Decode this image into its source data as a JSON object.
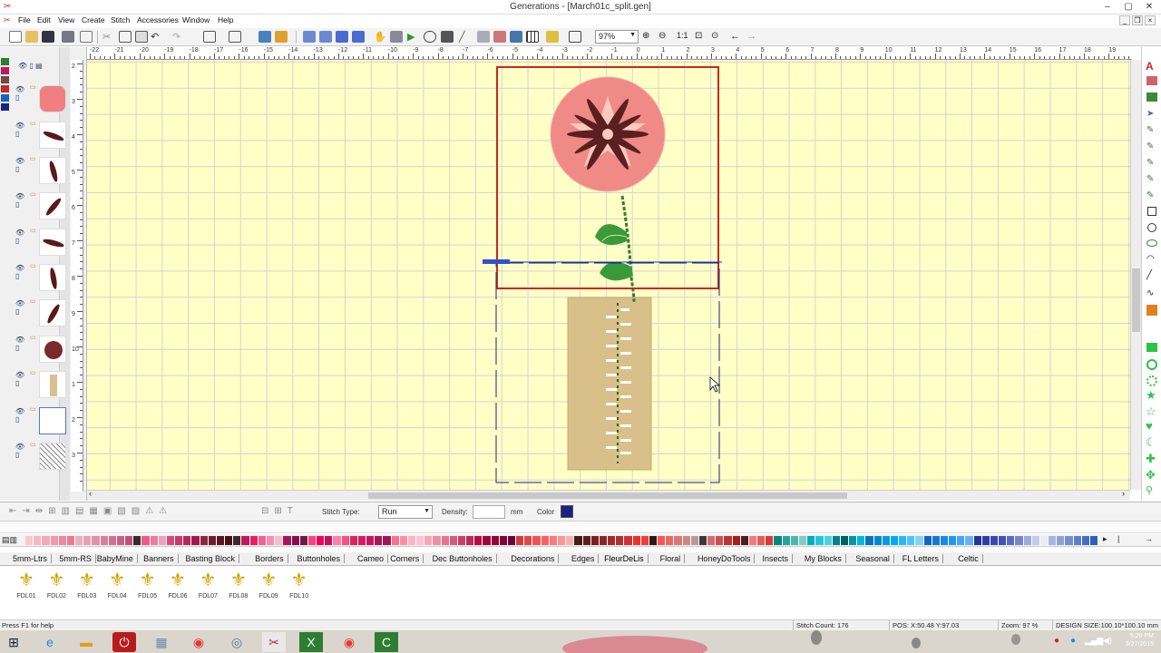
{
  "window": {
    "title": "Generations - [March01c_split.gen]",
    "minimize": "–",
    "maximize": "▢",
    "close": "✕"
  },
  "menu": [
    "File",
    "Edit",
    "View",
    "Create",
    "Stitch",
    "Accessories",
    "Window",
    "Help"
  ],
  "toolbar": {
    "zoom": "97%"
  },
  "hruler_ticks": [
    "-22",
    "-21",
    "-20",
    "-19",
    "-18",
    "-17",
    "-16",
    "-15",
    "-14",
    "-13",
    "-12",
    "-11",
    "-10",
    "-9",
    "-8",
    "-7",
    "-6",
    "-5",
    "-4",
    "-3",
    "-2",
    "-1",
    "0",
    "1",
    "2",
    "3",
    "4",
    "5",
    "6",
    "7",
    "8",
    "9",
    "10",
    "11",
    "12",
    "13",
    "14",
    "15",
    "16",
    "17",
    "18",
    "19"
  ],
  "vruler_ticks": [
    "2",
    "3",
    "4",
    "5",
    "6",
    "7",
    "8",
    "9",
    "10",
    "1",
    "2",
    "3"
  ],
  "properties": {
    "stitch_type_label": "Stitch Type:",
    "stitch_type_value": "Run",
    "density_label": "Density:",
    "density_unit": "mm",
    "color_label": "Color",
    "color_value": "#1a237e"
  },
  "thread_colors": [
    "#f8c8d0",
    "#f6b8c4",
    "#f4a8b8",
    "#f298ac",
    "#f0889f",
    "#ee7893",
    "#e9b0c0",
    "#e5a0b5",
    "#e090aa",
    "#d9809e",
    "#d27093",
    "#c96088",
    "#be507c",
    "#3a2a2a",
    "#ef5a8a",
    "#f07aa0",
    "#f2a0bc",
    "#d94a7a",
    "#c73a6a",
    "#b32a5a",
    "#9f1a4a",
    "#8a2a3a",
    "#701e2e",
    "#5c1622",
    "#4a1018",
    "#3a2a2a",
    "#c2185b",
    "#e91e63",
    "#f06292",
    "#f48fb1",
    "#f8bbd0",
    "#ad1457",
    "#880e4f",
    "#6a1b4a",
    "#ff4081",
    "#f50057",
    "#c51162",
    "#ff80ab",
    "#ff4d7e",
    "#e0245e",
    "#d81b60",
    "#c2185b",
    "#ad1457",
    "#9c1a52",
    "#ff6f91",
    "#ff8fa8",
    "#ffb3c4",
    "#ffc1d0",
    "#f7a8b8",
    "#ef8ea4",
    "#e57390",
    "#d95a7c",
    "#cc4068",
    "#bf2754",
    "#b20e40",
    "#a3003c",
    "#93003a",
    "#830038",
    "#720036",
    "#d23c3c",
    "#e04848",
    "#ee5454",
    "#ff6060",
    "#ff7a7a",
    "#ff9494",
    "#ffaeae",
    "#4a1a1a",
    "#601e1e",
    "#762222",
    "#8c2626",
    "#a22a2a",
    "#b82e2e",
    "#ce3232",
    "#e43636",
    "#fa3a3a",
    "#2a1a1a",
    "#ff5555",
    "#ee6666",
    "#dd7777",
    "#cc8888",
    "#bb9999",
    "#3a3a3a",
    "#d86a6a",
    "#c95050",
    "#ba3636",
    "#ab1c1c",
    "#4a2020",
    "#f27b7b",
    "#e55a5a",
    "#d83939",
    "#00897b",
    "#26a69a",
    "#4db6ac",
    "#80cbc4",
    "#00acc1",
    "#26c6da",
    "#4dd0e1",
    "#00838f",
    "#006064",
    "#0097a7",
    "#00b8d4",
    "#0277bd",
    "#0288d1",
    "#039be5",
    "#03a9f4",
    "#29b6f6",
    "#4fc3f7",
    "#81d4fa",
    "#1565c0",
    "#1976d2",
    "#1e88e5",
    "#2196f3",
    "#42a5f5",
    "#64b5f6",
    "#283593",
    "#303f9f",
    "#3949ab",
    "#3f51b5",
    "#5c6bc0",
    "#7986cb",
    "#9fa8da",
    "#c5cae9",
    "#e8eaf6",
    "#a6b4e0",
    "#8ea0d8",
    "#7590d0",
    "#5c80c8",
    "#4470c0",
    "#2c60b8"
  ],
  "library_tabs": [
    "5mm-Ltrs",
    "5mm-RS",
    "BabyMine",
    "Banners",
    "Basting Block",
    "Borders",
    "Buttonholes",
    "Cameo",
    "Corners",
    "Dec Buttonholes",
    "Decorations",
    "Edges",
    "FleurDeLis",
    "Floral",
    "HoneyDoTools",
    "Insects",
    "My Blocks",
    "Seasonal",
    "FL Letters",
    "Celtic"
  ],
  "library_active": "FleurDeLis",
  "library_items": [
    "FDL01",
    "FDL02",
    "FDL03",
    "FDL04",
    "FDL05",
    "FDL06",
    "FDL07",
    "FDL08",
    "FDL09",
    "FDL10"
  ],
  "status": {
    "help": "Press F1 for help",
    "stitch_count": "Stitch Count: 176",
    "pos": "POS: X:50.48    Y:97.03",
    "zoom": "Zoom: 97 %",
    "design_size": "DESIGN SIZE:100.10*100.10 mm"
  },
  "clock": {
    "time": "5:20 PM",
    "date": "3/27/2015"
  },
  "icons": [
    "new-icon",
    "open-icon",
    "save-icon",
    "print-icon",
    "cut-icon",
    "copy-icon",
    "paste-icon",
    "undo-icon",
    "redo-icon",
    "hand-icon",
    "play-icon",
    "zoom-in-icon",
    "zoom-out-icon",
    "back-arrow-icon",
    "forward-arrow-icon",
    "start-icon",
    "ie-icon",
    "folder-icon",
    "power-icon",
    "chrome-icon",
    "generations-icon",
    "excel-icon"
  ]
}
